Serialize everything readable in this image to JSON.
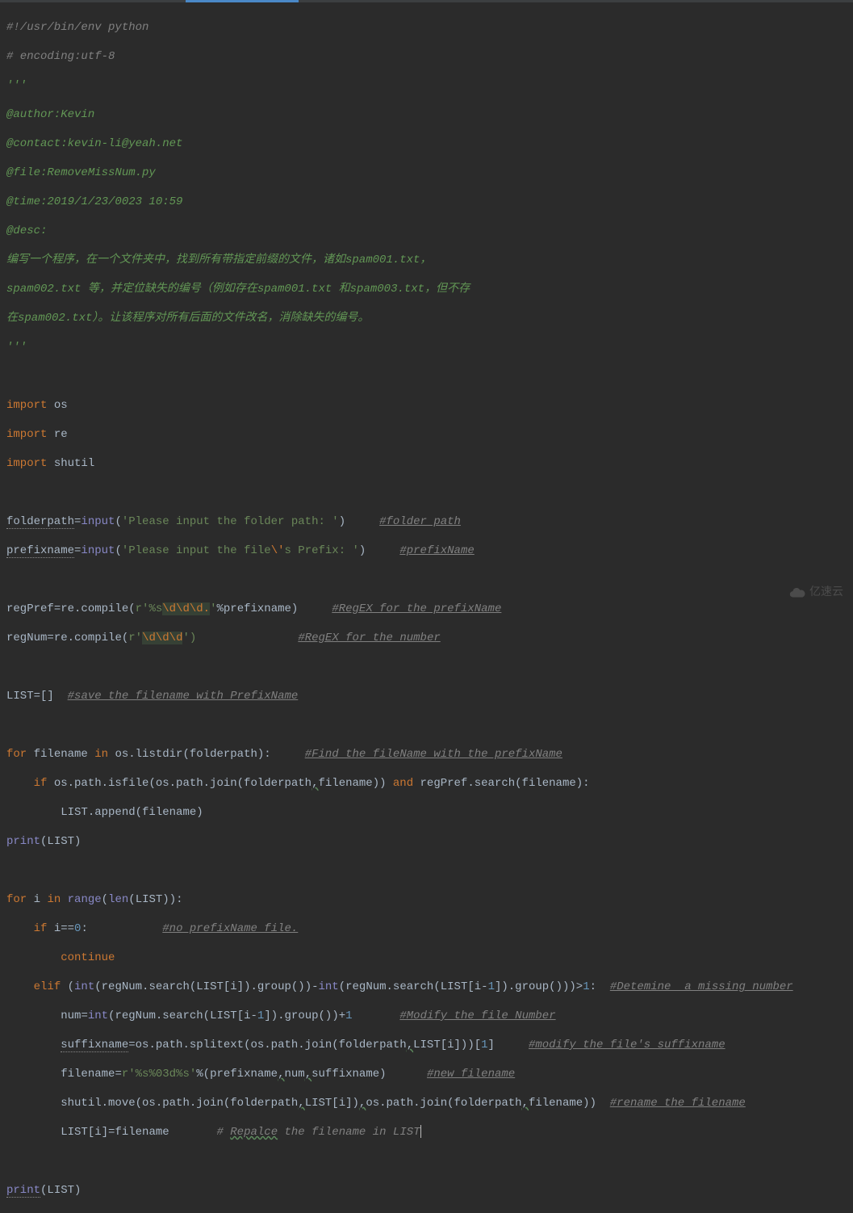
{
  "shebang": "#!/usr/bin/env python",
  "encoding": "# encoding:utf-8",
  "docstring_open": "'''",
  "doc_author": "@author:Kevin",
  "doc_contact": "@contact:kevin-li@yeah.net",
  "doc_file": "@file:RemoveMissNum.py",
  "doc_time": "@time:2019/1/23/0023 10:59",
  "doc_desc": "@desc:",
  "doc_body_1": "编写一个程序，在一个文件夹中，找到所有带指定前缀的文件，诸如",
  "doc_spam1": "spam001.txt",
  "doc_body_1b": "，",
  "doc_spam2": "spam002.txt",
  "doc_body_2": " 等，并定位缺失的编号（例如存在",
  "doc_spam3": "spam001.txt",
  "doc_body_2b": " 和",
  "doc_spam4": "spam003.txt",
  "doc_body_2c": "，但不存",
  "doc_body_3a": "在",
  "doc_spam5": "spam002.txt",
  "doc_body_3b": "）。让该程序对所有后面的文件改名，消除缺失的编号。",
  "docstring_close": "'''",
  "import_kw": "import",
  "import_os": " os",
  "import_re": " re",
  "import_shutil": " shutil",
  "folderpath_lhs": "folderpath",
  "eq": "=",
  "input_fn": "input",
  "open_paren": "(",
  "close_paren": ")",
  "folder_prompt": "'Please input the folder path: '",
  "folder_comment": "#folder path",
  "prefixname_lhs": "prefixname",
  "prefix_prompt_a": "'Please input the file",
  "prefix_prompt_esc": "\\'",
  "prefix_prompt_b": "s Prefix: '",
  "prefix_comment": "#prefixName",
  "regpref_lhs": "regPref",
  "re_compile": "re.compile(",
  "r_prefix": "r",
  "regpref_str_a": "'%s",
  "regpref_pat": "\\d\\d\\d.",
  "regpref_str_b": "'",
  "percent_prefix": "%prefixname)",
  "regpref_comment": "#RegEX for the prefixName",
  "regnum_lhs": "regNum",
  "regnum_pat": "\\d\\d\\d",
  "regnum_close": "')",
  "regnum_comment": "#RegEX for the number",
  "list_lhs": "LIST",
  "list_val": "[]",
  "list_comment": "#save the filename with PrefixName",
  "for_kw": "for",
  "in_kw": "in",
  "filename_var": " filename ",
  "os_listdir": " os.listdir(folderpath):",
  "find_comment": "#Find the fileName with the prefixName",
  "if_kw": "if",
  "isfile_expr": " os.path.isfile(os.path.join(folderpath",
  "comma": ",",
  "filename_arg": "filename)) ",
  "and_kw": "and",
  "regpref_search": " regPref.search(filename):",
  "list_append": "LIST.append(filename)",
  "print_kw": "print",
  "print_arg": "(LIST)",
  "i_var": " i ",
  "range_kw": "range",
  "len_kw": "len",
  "len_arg": "(LIST)):",
  "i_eq0": " i",
  "eqeq": "==",
  "zero": "0",
  "colon": ":",
  "no_prefix_comment": "#no prefixName file.",
  "continue_kw": "continue",
  "elif_kw": "elif",
  "elif_open": " (",
  "int_kw": "int",
  "regnum_search_a": "(regNum.search(LIST[i]).group())-",
  "regnum_search_b": "(regNum.search(LIST[i-",
  "one": "1",
  "group_close": "]).group()))",
  "gt": ">",
  "detemine_comment": "#Detemine  a missing number",
  "num_lhs": "num",
  "num_expr": "(regNum.search(LIST[i-",
  "num_close": "]).group())+",
  "modify_num_comment": "#Modify the file Number",
  "suffix_lhs": "suffixname",
  "suffix_expr": "os.path.splitext(os.path.join(folderpath",
  "suffix_list": "LIST[i]))[",
  "suffix_close": "]",
  "modify_suffix_comment": "#modify the file's suffixname",
  "filename_lhs": "filename",
  "fmt_str": "'%s%03d%s'",
  "fmt_args": "%(prefixname",
  "num_arg": "num",
  "suffix_arg": "suffixname)",
  "new_filename_comment": "#new filename",
  "shutil_move": "shutil.move(os.path.join(folderpath",
  "list_i": "LIST[i])",
  "os_join2": "os.path.join(folderpath",
  "filename_close": "filename))",
  "rename_comment": "#rename the filename",
  "list_assign": "LIST[i]",
  "filename_val": "filename",
  "replace_comment_hash": "# ",
  "replace_word": "Repalce",
  "replace_rest": " the filename in LIST",
  "watermark_text": "亿速云"
}
